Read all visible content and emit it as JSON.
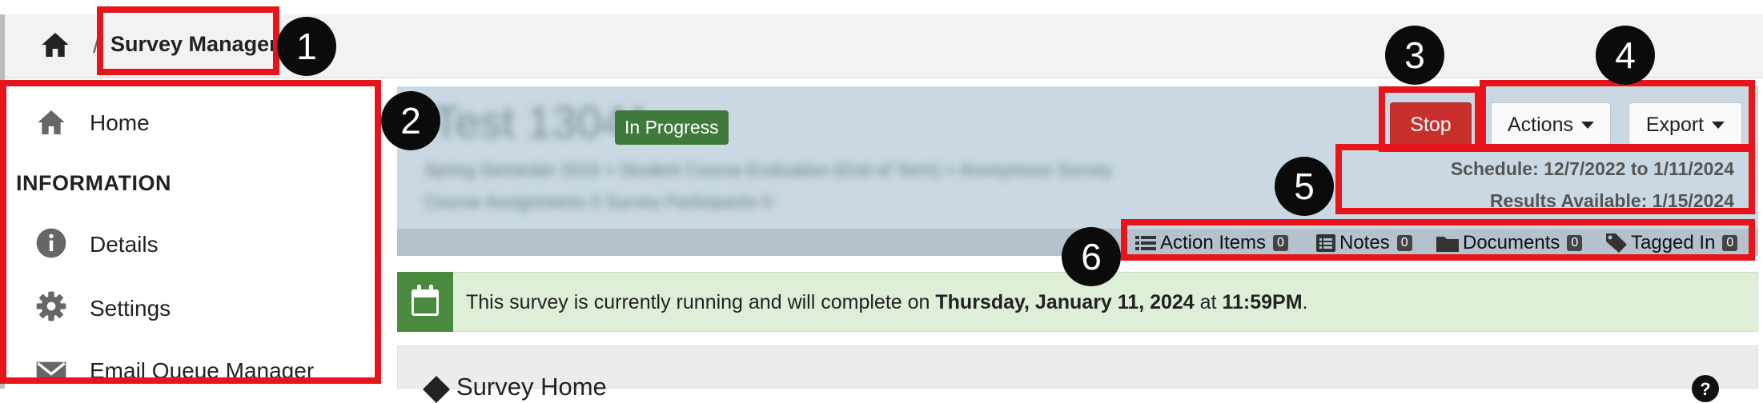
{
  "breadcrumb": {
    "separator": "/",
    "title": "Survey Manager"
  },
  "sidebar": {
    "items": [
      {
        "label": "Home",
        "icon": "home-icon"
      },
      {
        "label": "Details",
        "icon": "info-icon"
      },
      {
        "label": "Settings",
        "icon": "gear-icon"
      },
      {
        "label": "Email Queue Manager",
        "icon": "mail-icon"
      }
    ],
    "heading": "INFORMATION"
  },
  "header": {
    "survey_title": "Test 13041",
    "status_badge": "In Progress",
    "subtitle_line1": "Spring Semester 2015 > Student Course Evaluation (End of Term) > Anonymous Survey",
    "subtitle_line2": "Course Assignments 0 Survey Participants 0",
    "buttons": {
      "stop": "Stop",
      "actions": "Actions",
      "export": "Export"
    },
    "schedule": "Schedule: 12/7/2022 to 1/11/2024",
    "results": "Results Available: 1/15/2024",
    "tabs": [
      {
        "label": "Action Items",
        "count": "0",
        "icon": "list-icon"
      },
      {
        "label": "Notes",
        "count": "0",
        "icon": "notes-icon"
      },
      {
        "label": "Documents",
        "count": "0",
        "icon": "folder-icon"
      },
      {
        "label": "Tagged In",
        "count": "0",
        "icon": "tag-icon"
      }
    ]
  },
  "alert": {
    "text_before": "This survey is currently running and will complete on ",
    "date": "Thursday, January 11, 2024",
    "text_mid": " at ",
    "time": "11:59PM",
    "text_after": ".",
    "icon": "calendar-icon"
  },
  "survey_home": {
    "title": "Survey Home",
    "help_icon": "question-icon"
  },
  "annotations": [
    "1",
    "2",
    "3",
    "4",
    "5",
    "6"
  ],
  "colors": {
    "annotation_red": "#e8141c",
    "stop_red": "#c9302c",
    "badge_green": "#3f7a3a",
    "alert_bg": "#dfeed6"
  }
}
